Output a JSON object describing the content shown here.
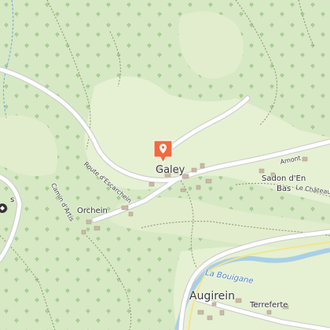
{
  "map": {
    "place_labels": {
      "galey": "Galey",
      "orchein": "Orchein",
      "augirein": "Augirein",
      "sadon_line1": "Sadon d'En",
      "sadon_line2": "Bas",
      "terreferte": "Terreferte",
      "edge_s": "s"
    },
    "road_labels": {
      "route_escarchein": "Route d'Escarchein",
      "cami_artis": "Camin d'Artis",
      "amont": "Amont",
      "le_chateau": "Le Château"
    },
    "water_labels": {
      "la_bouigane": "La Bouigane"
    },
    "marker": {
      "icon": "location-pin-icon",
      "color": "#f26a3d"
    },
    "colors": {
      "forest": "#d6e8c4",
      "meadow": "#e6f0d3",
      "river": "#a8cfe6",
      "road": "#ffffff",
      "track": "#8f8f6e"
    }
  }
}
